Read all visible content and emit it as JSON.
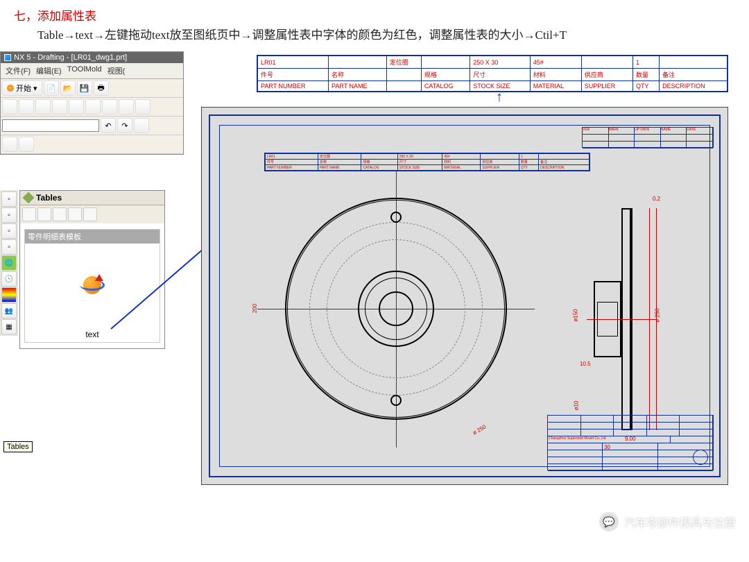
{
  "heading": {
    "number": "七，",
    "title": "添加属性表"
  },
  "body": "Table→text→左键拖动text放至图纸页中→调整属性表中字体的颜色为红色，调整属性表的大小→Ctil+T",
  "nx": {
    "title": "NX 5 - Drafting - [LR01_dwg1.prt]",
    "menu": [
      "文件(F)",
      "编辑(E)",
      "TOOlMold",
      "视图("
    ],
    "start_btn": "开始",
    "dropdown": ""
  },
  "panel": {
    "title": "Tables",
    "template_header": "零件明细表模板",
    "template_label": "text",
    "tooltip": "Tables"
  },
  "attr_table": {
    "row1": [
      "LR01",
      "",
      "定位圈",
      "",
      "250 X 30",
      "45#",
      "",
      "1",
      ""
    ],
    "row2": [
      "件号",
      "名称",
      "",
      "规格",
      "尺寸",
      "材料",
      "供应商",
      "数量",
      "备注"
    ],
    "row3": [
      "PART NUMBER",
      "PART NAME",
      "",
      "CATALOG",
      "STOCK SIZE",
      "MATERIAL",
      "SUPPLIER",
      "QTY",
      "DESCRIPTION"
    ]
  },
  "arrow_up": "↑",
  "dims": {
    "d200": "200",
    "d250": "ø 250",
    "d150": "ø150",
    "d30": "30",
    "d10_5": "10.5",
    "d9": "9.00",
    "d0_2": "0.2",
    "d_phi10": "ø10"
  },
  "rev_headers": [
    "VER",
    "MARK",
    "UP DATA",
    "NAME",
    "DATE"
  ],
  "title_block_text": "Changzhou Superstart Mould Co.,Ltd",
  "watermark": {
    "text": "汽车零部件模具与注塑"
  }
}
